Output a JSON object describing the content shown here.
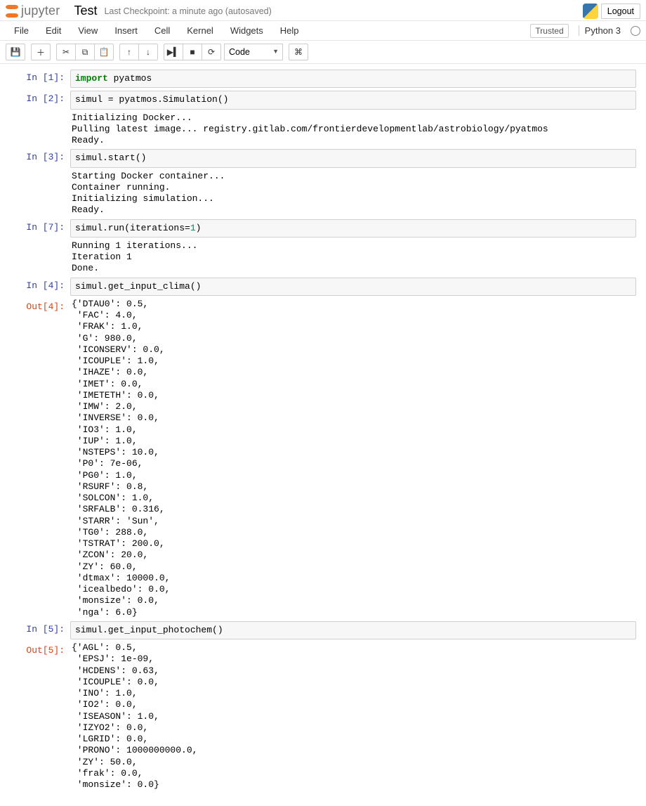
{
  "header": {
    "logo_text": "jupyter",
    "notebook_name": "Test",
    "checkpoint": "Last Checkpoint: a minute ago (autosaved)",
    "logout": "Logout"
  },
  "menubar": {
    "items": [
      "File",
      "Edit",
      "View",
      "Insert",
      "Cell",
      "Kernel",
      "Widgets",
      "Help"
    ],
    "trusted": "Trusted",
    "kernel": "Python 3"
  },
  "toolbar": {
    "save_icon": "💾",
    "add_icon": "＋",
    "cut_icon": "✂",
    "copy_icon": "⧉",
    "paste_icon": "📋",
    "up_icon": "↑",
    "down_icon": "↓",
    "run_icon": "▶▍",
    "stop_icon": "■",
    "restart_icon": "⟳",
    "cell_type": "Code",
    "cmd_icon": "⌘"
  },
  "cells": [
    {
      "in_prompt": "In [1]:",
      "code_html": "<span class='kw'>import</span> pyatmos"
    },
    {
      "in_prompt": "In [2]:",
      "code_html": "simul = pyatmos.Simulation()",
      "stream": "Initializing Docker...\nPulling latest image... registry.gitlab.com/frontierdevelopmentlab/astrobiology/pyatmos\nReady."
    },
    {
      "in_prompt": "In [3]:",
      "code_html": "simul.start()",
      "stream": "Starting Docker container...\nContainer running.\nInitializing simulation...\nReady."
    },
    {
      "in_prompt": "In [7]:",
      "code_html": "simul.run(iterations=<span class='num'>1</span>)",
      "stream": "Running 1 iterations...\nIteration 1\nDone."
    },
    {
      "in_prompt": "In [4]:",
      "code_html": "simul.get_input_clima()",
      "out_prompt": "Out[4]:",
      "plain": "{'DTAU0': 0.5,\n 'FAC': 4.0,\n 'FRAK': 1.0,\n 'G': 980.0,\n 'ICONSERV': 0.0,\n 'ICOUPLE': 1.0,\n 'IHAZE': 0.0,\n 'IMET': 0.0,\n 'IMETETH': 0.0,\n 'IMW': 2.0,\n 'INVERSE': 0.0,\n 'IO3': 1.0,\n 'IUP': 1.0,\n 'NSTEPS': 10.0,\n 'P0': 7e-06,\n 'PG0': 1.0,\n 'RSURF': 0.8,\n 'SOLCON': 1.0,\n 'SRFALB': 0.316,\n 'STARR': 'Sun',\n 'TG0': 288.0,\n 'TSTRAT': 200.0,\n 'ZCON': 20.0,\n 'ZY': 60.0,\n 'dtmax': 10000.0,\n 'icealbedo': 0.0,\n 'monsize': 0.0,\n 'nga': 6.0}"
    },
    {
      "in_prompt": "In [5]:",
      "code_html": "simul.get_input_photochem<span class='call'>()</span>",
      "out_prompt": "Out[5]:",
      "plain": "{'AGL': 0.5,\n 'EPSJ': 1e-09,\n 'HCDENS': 0.63,\n 'ICOUPLE': 0.0,\n 'INO': 1.0,\n 'IO2': 0.0,\n 'ISEASON': 1.0,\n 'IZYO2': 0.0,\n 'LGRID': 0.0,\n 'PRONO': 1000000000.0,\n 'ZY': 50.0,\n 'frak': 0.0,\n 'monsize': 0.0}"
    }
  ]
}
